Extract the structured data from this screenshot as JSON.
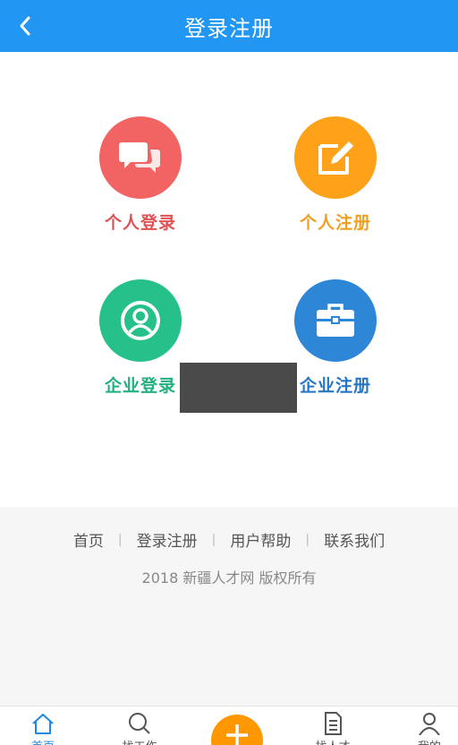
{
  "header": {
    "title": "登录注册",
    "back_icon": "chevron-left-icon"
  },
  "tiles": [
    {
      "label": "个人登录",
      "icon": "chat-bubbles-icon",
      "color": "#f16463",
      "text_color": "#e05252"
    },
    {
      "label": "个人注册",
      "icon": "edit-icon",
      "color": "#ffa21a",
      "text_color": "#f0a020"
    },
    {
      "label": "企业登录",
      "icon": "user-circle-icon",
      "color": "#26c08a",
      "text_color": "#22b07e"
    },
    {
      "label": "企业注册",
      "icon": "briefcase-icon",
      "color": "#2d86d6",
      "text_color": "#2676c4"
    }
  ],
  "footer": {
    "links": [
      "首页",
      "登录注册",
      "用户帮助",
      "联系我们"
    ],
    "copyright": "2018 新疆人才网 版权所有"
  },
  "tabbar": {
    "tabs": [
      {
        "label": "首页",
        "icon": "home-icon"
      },
      {
        "label": "找工作",
        "icon": "search-icon"
      },
      {
        "label": "找人才",
        "icon": "document-icon"
      },
      {
        "label": "我的",
        "icon": "user-icon"
      }
    ],
    "plus_icon": "plus-icon",
    "accent": "#1e88e5",
    "plus_color": "#ff9800"
  }
}
